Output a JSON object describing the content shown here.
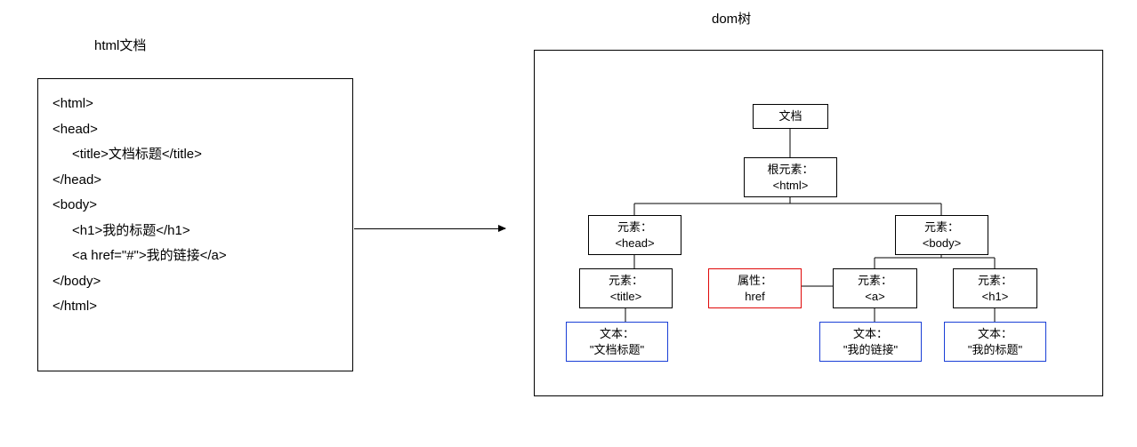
{
  "left": {
    "heading": "html文档",
    "code": {
      "l1": "<html>",
      "l2": "<head>",
      "l3": "<title>文档标题</title>",
      "l4": "</head>",
      "l5": "<body>",
      "l6": "<h1>我的标题</h1>",
      "l7": "<a href=\"#\">我的链接</a>",
      "l8": "",
      "l9": "</body>",
      "l10": "</html>"
    }
  },
  "right": {
    "heading": "dom树",
    "nodes": {
      "doc": "文档",
      "root_l1": "根元素：",
      "root_l2": "<html>",
      "head_l1": "元素：",
      "head_l2": "<head>",
      "body_l1": "元素：",
      "body_l2": "<body>",
      "title_l1": "元素：",
      "title_l2": "<title>",
      "href_l1": "属性：",
      "href_l2": "href",
      "a_l1": "元素：",
      "a_l2": "<a>",
      "h1_l1": "元素：",
      "h1_l2": "<h1>",
      "txt1_l1": "文本：",
      "txt1_l2": "\"文档标题\"",
      "txt2_l1": "文本：",
      "txt2_l2": "\"我的链接\"",
      "txt3_l1": "文本：",
      "txt3_l2": "\"我的标题\""
    }
  }
}
